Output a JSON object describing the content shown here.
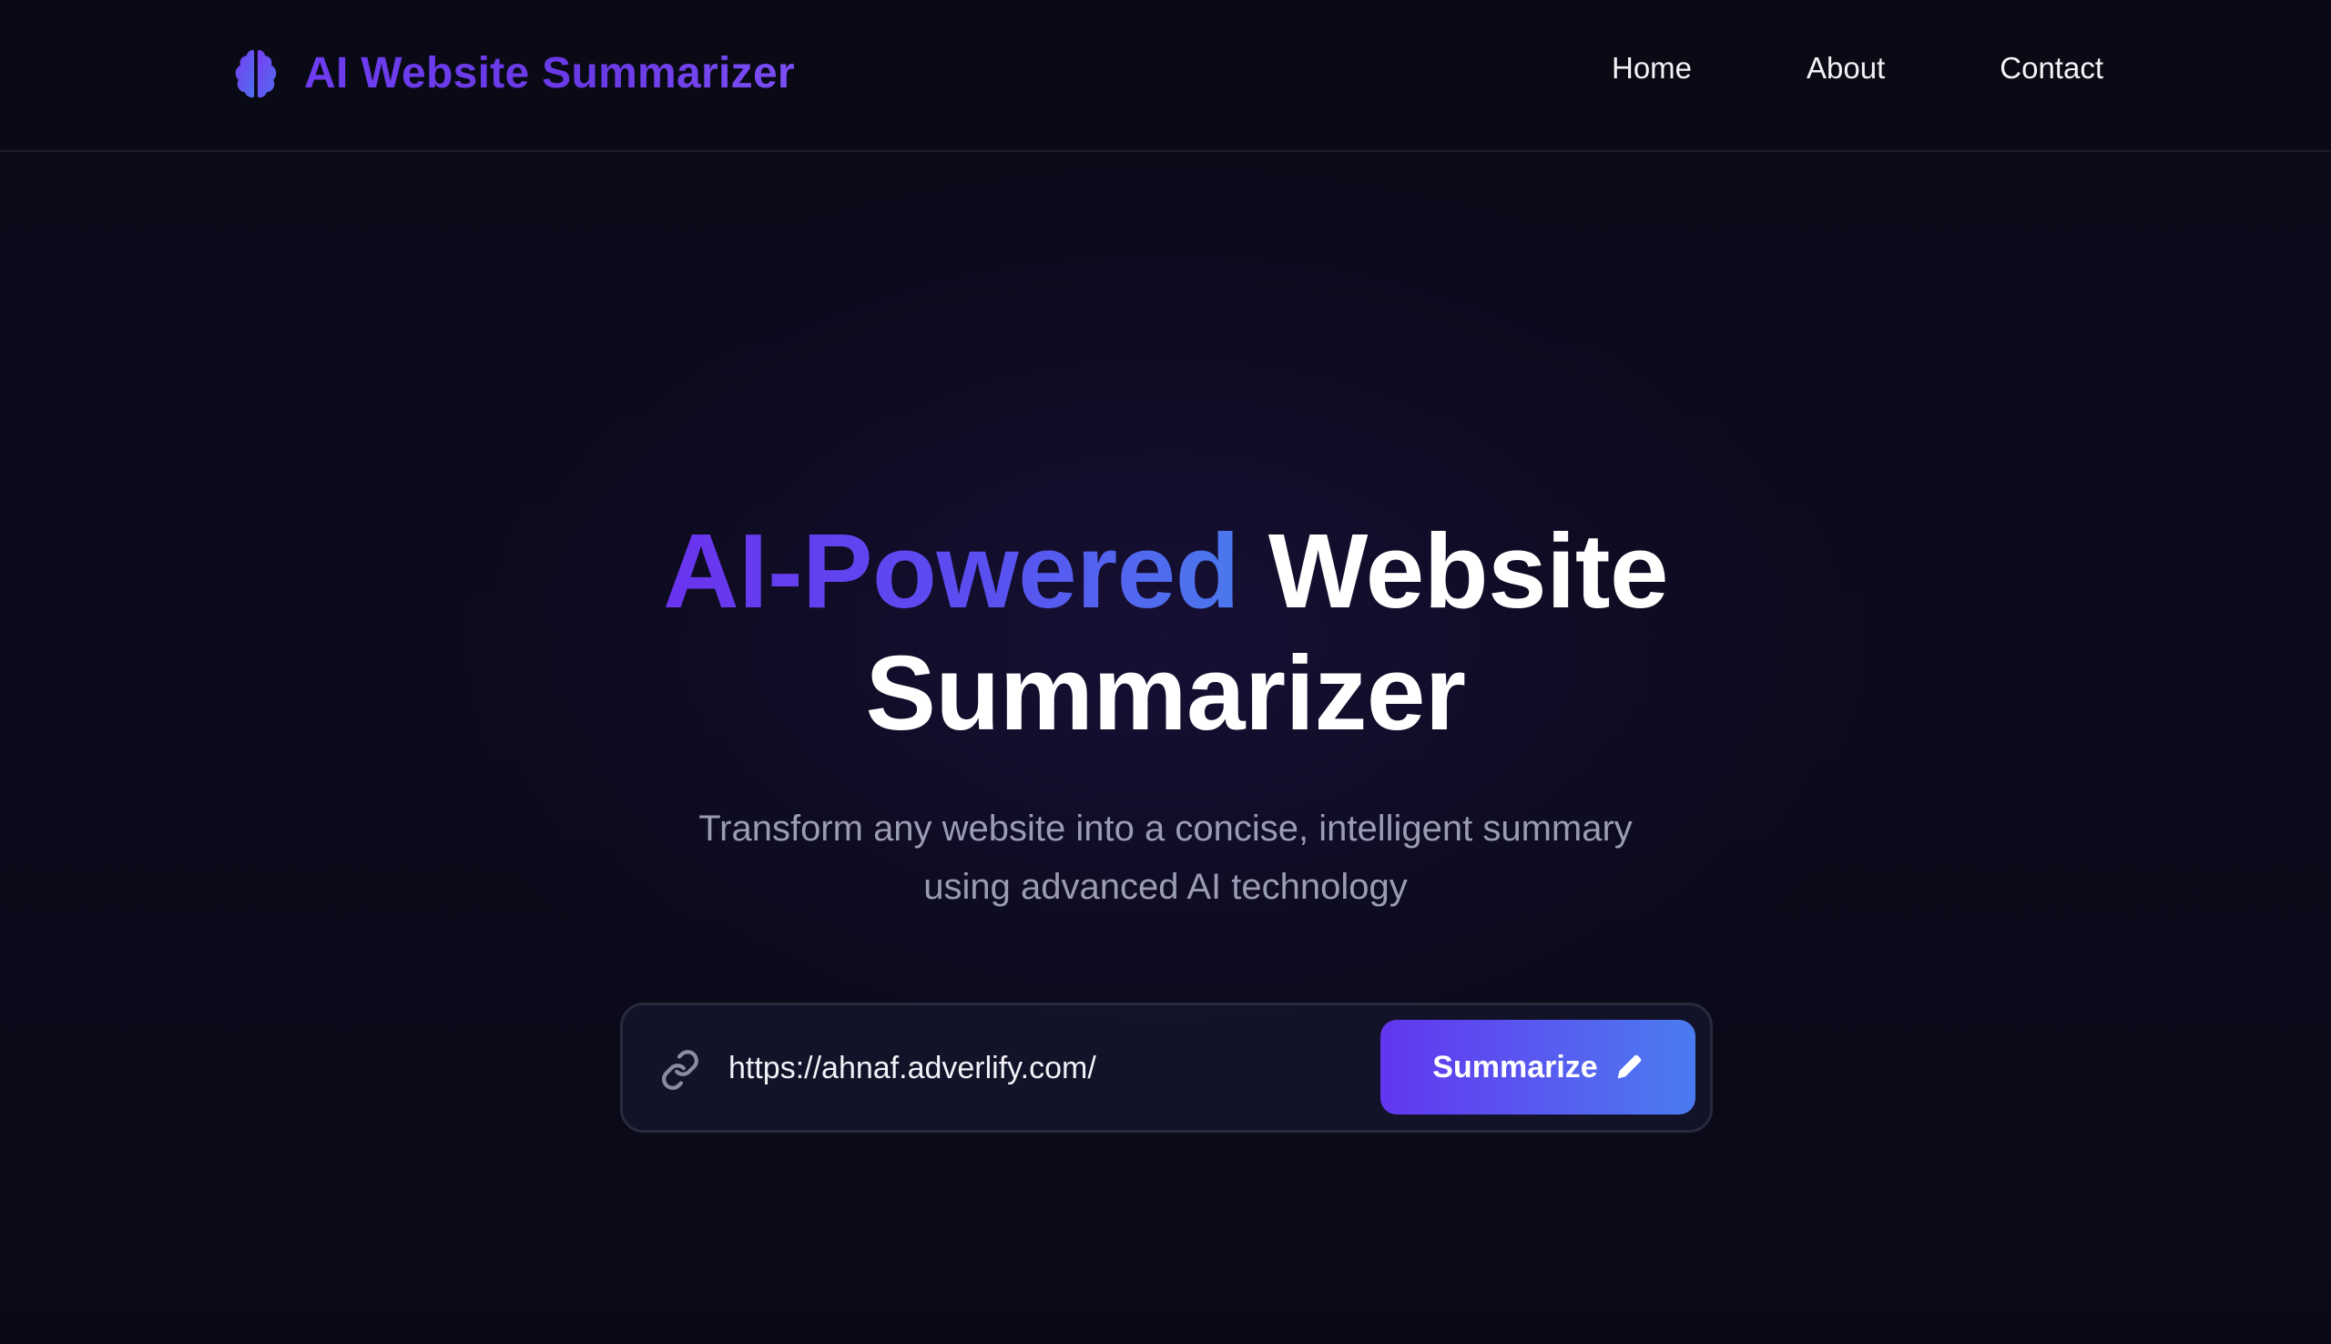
{
  "brand": {
    "title": "AI Website Summarizer",
    "icon": "brain-icon"
  },
  "nav": {
    "items": [
      {
        "label": "Home"
      },
      {
        "label": "About"
      },
      {
        "label": "Contact"
      }
    ]
  },
  "hero": {
    "title_accent": "AI-Powered",
    "title_rest_line1": "Website",
    "title_line2": "Summarizer",
    "subtitle_line1": "Transform any website into a concise, intelligent summary",
    "subtitle_line2": "using advanced AI technology"
  },
  "search": {
    "icon": "link-icon",
    "value": "https://ahnaf.adverlify.com/",
    "button_label": "Summarize",
    "button_icon": "pencil-icon"
  },
  "colors": {
    "background": "#0b0a1a",
    "accent_purple": "#6a33ee",
    "accent_blue": "#4b78ee",
    "nav_text": "#f3f3f7",
    "subtitle_text": "#9a9cb3"
  }
}
